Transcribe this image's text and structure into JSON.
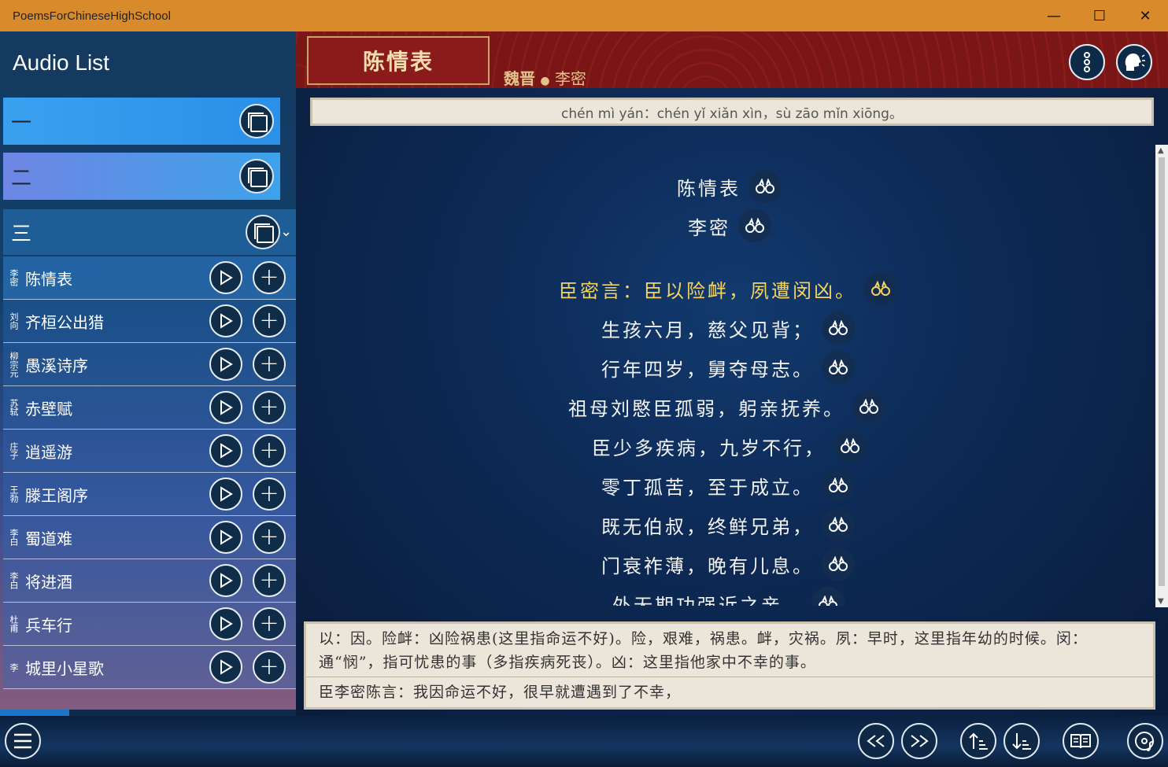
{
  "window": {
    "title": "PoemsForChineseHighSchool",
    "minimize": "—",
    "maximize": "☐",
    "close": "✕"
  },
  "sidebar": {
    "title": "Audio List",
    "groups": [
      {
        "label": "一"
      },
      {
        "label": "二"
      },
      {
        "label": "三"
      }
    ],
    "items": [
      {
        "author": "李密",
        "title": "陈情表"
      },
      {
        "author": "刘向",
        "title": "齐桓公出猎"
      },
      {
        "author": "柳宗元",
        "title": "愚溪诗序"
      },
      {
        "author": "苏轼",
        "title": "赤壁赋"
      },
      {
        "author": "庄子",
        "title": "逍遥游"
      },
      {
        "author": "王勃",
        "title": "滕王阁序"
      },
      {
        "author": "李白",
        "title": "蜀道难"
      },
      {
        "author": "李白",
        "title": "将进酒"
      },
      {
        "author": "杜甫",
        "title": "兵车行"
      },
      {
        "author": "李",
        "title": "城里小星歌"
      }
    ],
    "nav": [
      "list-icon",
      "history-icon",
      "heart-icon",
      "tools-icon"
    ]
  },
  "poem": {
    "title": "陈情表",
    "dynasty": "魏晋",
    "dot": "●",
    "author": "李密",
    "pinyin": "chén mì yán：chén yǐ xiǎn xìn，sù zāo mǐn xiōng。",
    "lines": [
      "陈情表",
      "李密",
      "臣密言：臣以险衅，夙遭闵凶。",
      "生孩六月，慈父见背；",
      "行年四岁，舅夺母志。",
      "祖母刘愍臣孤弱，躬亲抚养。",
      "臣少多疾病，九岁不行，",
      "零丁孤苦，至于成立。",
      "既无伯叔，终鲜兄弟，",
      "门衰祚薄，晚有儿息。",
      "外无期功强近之亲，"
    ],
    "highlight_index": 2,
    "note": "以：因。险衅：凶险祸患(这里指命运不好)。险，艰难，祸患。衅，灾祸。夙：早时，这里指年幼的时候。闵：通“悯”，指可忧患的事（多指疾病死丧）。凶：这里指他家中不幸的事。",
    "translation": "臣李密陈言：我因命运不好，很早就遭遇到了不幸，"
  },
  "colors": {
    "titlebar": "#d98b2b",
    "banner": "#7a1616",
    "highlight": "#f4d35e",
    "active_nav": "#1d76c8"
  }
}
